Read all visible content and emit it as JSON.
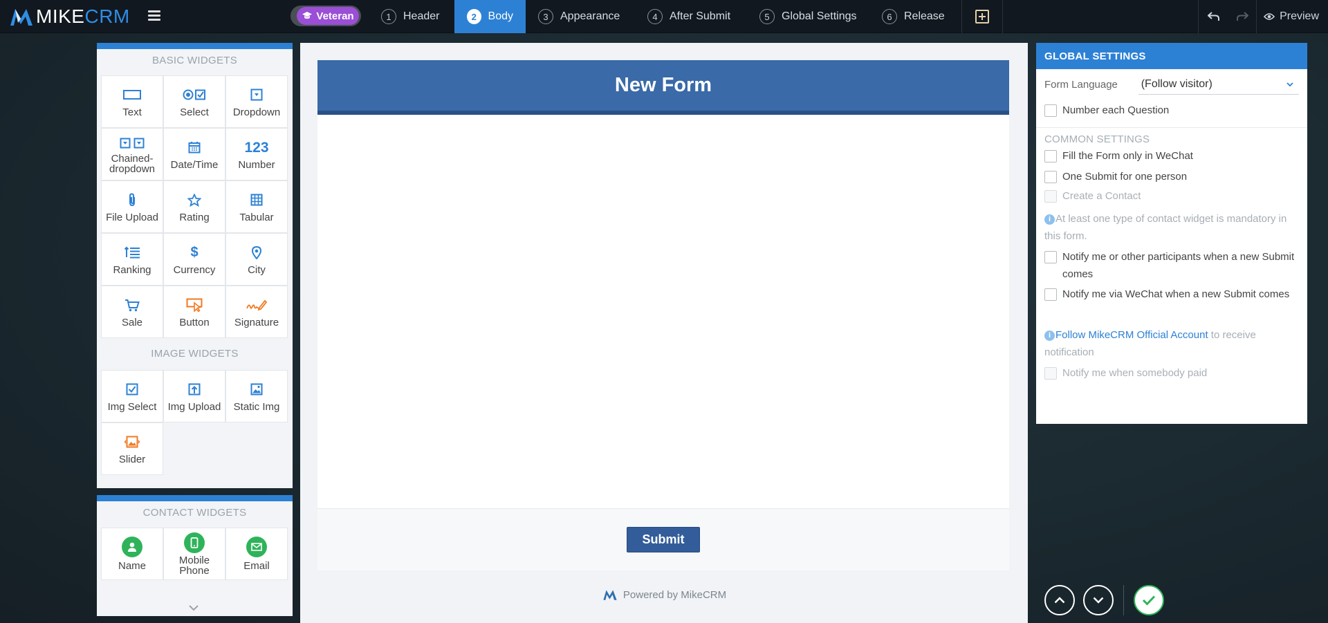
{
  "app": {
    "logo_text_a": "MIKE",
    "logo_text_b": "CRM",
    "badge": "Veteran"
  },
  "steps": [
    {
      "num": "1",
      "label": "Header"
    },
    {
      "num": "2",
      "label": "Body"
    },
    {
      "num": "3",
      "label": "Appearance"
    },
    {
      "num": "4",
      "label": "After Submit"
    },
    {
      "num": "5",
      "label": "Global Settings"
    },
    {
      "num": "6",
      "label": "Release"
    }
  ],
  "toolbar": {
    "preview_label": "Preview"
  },
  "basic_widgets": {
    "title": "BASIC WIDGETS",
    "items": [
      {
        "label": "Text",
        "icon": "text-field-icon"
      },
      {
        "label": "Select",
        "icon": "radio-check-icon"
      },
      {
        "label": "Dropdown",
        "icon": "dropdown-icon"
      },
      {
        "label": "Chained-dropdown",
        "icon": "chained-dropdown-icon"
      },
      {
        "label": "Date/Time",
        "icon": "calendar-icon"
      },
      {
        "label": "Number",
        "icon": "number-icon",
        "glyph": "123"
      },
      {
        "label": "File Upload",
        "icon": "paperclip-icon"
      },
      {
        "label": "Rating",
        "icon": "star-icon"
      },
      {
        "label": "Tabular",
        "icon": "table-grid-icon"
      },
      {
        "label": "Ranking",
        "icon": "ranking-icon"
      },
      {
        "label": "Currency",
        "icon": "dollar-icon",
        "glyph": "$"
      },
      {
        "label": "City",
        "icon": "location-pin-icon"
      },
      {
        "label": "Sale",
        "icon": "cart-icon"
      },
      {
        "label": "Button",
        "icon": "button-click-icon"
      },
      {
        "label": "Signature",
        "icon": "signature-icon"
      }
    ]
  },
  "image_widgets": {
    "title": "IMAGE WIDGETS",
    "items": [
      {
        "label": "Img Select",
        "icon": "image-select-icon"
      },
      {
        "label": "Img Upload",
        "icon": "image-upload-icon"
      },
      {
        "label": "Static Img",
        "icon": "static-image-icon"
      },
      {
        "label": "Slider",
        "icon": "image-slider-icon"
      }
    ]
  },
  "contact_widgets": {
    "title": "CONTACT WIDGETS",
    "items": [
      {
        "label": "Name",
        "icon": "person-icon"
      },
      {
        "label": "Mobile Phone",
        "icon": "mobile-phone-icon"
      },
      {
        "label": "Email",
        "icon": "envelope-icon"
      }
    ]
  },
  "form": {
    "title": "New Form",
    "submit_label": "Submit",
    "powered_by": "Powered by MikeCRM"
  },
  "settings": {
    "title": "GLOBAL SETTINGS",
    "form_language_label": "Form Language",
    "form_language_value": "(Follow visitor)",
    "number_each_question": "Number each Question",
    "common_title": "COMMON SETTINGS",
    "fill_wechat": "Fill the Form only in WeChat",
    "one_submit": "One Submit for one person",
    "create_contact": "Create a Contact",
    "contact_note": "At least one type of contact widget is mandatory in this form.",
    "notify_participants": "Notify me or other participants when a new Submit comes",
    "notify_wechat": "Notify me via WeChat when a new Submit comes",
    "follow_link": "Follow MikeCRM Official Account",
    "follow_rest": " to receive notification",
    "notify_paid": "Notify me when somebody paid"
  },
  "colors": {
    "accent": "#2d81d4",
    "form_header": "#3a6aa7",
    "veteran": "#9a4fd6",
    "confirm": "#2fb35a"
  }
}
